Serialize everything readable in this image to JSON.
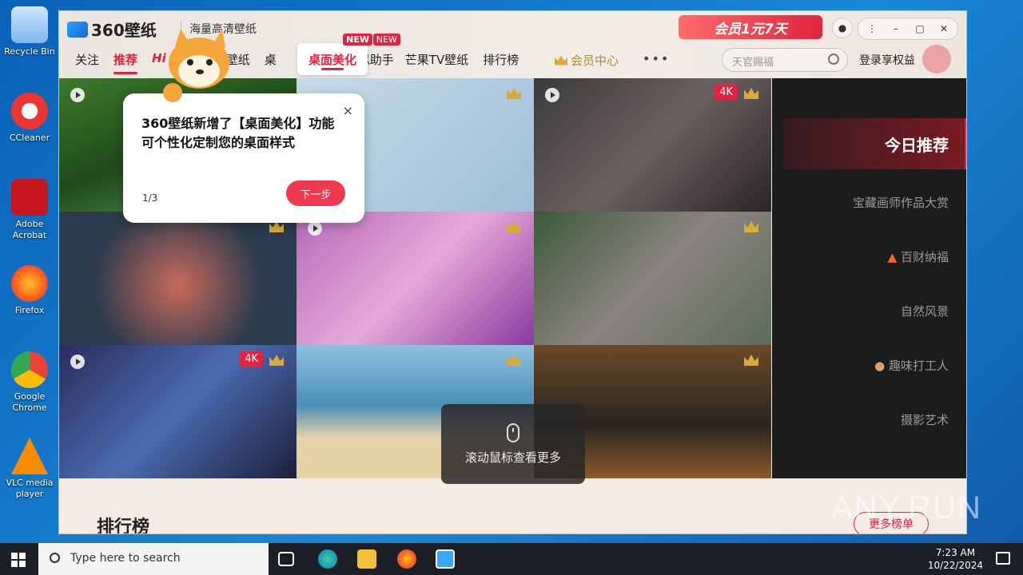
{
  "desktop": {
    "icons": [
      {
        "label": "Recycle Bin"
      },
      {
        "label": "CCleaner"
      },
      {
        "label": "Adobe Acrobat"
      },
      {
        "label": "Firefox"
      },
      {
        "label": "Google Chrome"
      },
      {
        "label": "VLC media player"
      }
    ]
  },
  "app": {
    "logo_text": "360壁纸",
    "subtitle": "海量高清壁纸",
    "promo": "会员1元7天",
    "nav": [
      {
        "label": "关注"
      },
      {
        "label": "推荐"
      },
      {
        "label": "动态壁纸"
      },
      {
        "label": "桌面美化",
        "badge": "NEW"
      },
      {
        "label": "AI助手",
        "badge": "NEW"
      },
      {
        "label": "芒果TV壁纸"
      },
      {
        "label": "排行榜"
      }
    ],
    "nav_fragments": {
      "fragment1": "关注",
      "fragment2": "推荐",
      "fragment3": "Hi",
      "fragment4": "经壁纸",
      "fragment5": "桌",
      "fragment6": "似助手"
    },
    "vip_label": "会员中心",
    "more_label": "•••",
    "search_placeholder": "天官赐福",
    "login_label": "登录享权益",
    "tile_badge": "4K",
    "side_menu": [
      {
        "label": "今日推荐"
      },
      {
        "label": "宝藏画师作品大赏"
      },
      {
        "label": "百财纳福"
      },
      {
        "label": "自然风景"
      },
      {
        "label": "趣味打工人"
      },
      {
        "label": "摄影艺术"
      }
    ],
    "popup": {
      "message": "360壁纸新增了【桌面美化】功能可个性化定制您的桌面样式",
      "step": "1/3",
      "next": "下一步",
      "close": "×"
    },
    "scroll_hint": "滚动鼠标查看更多",
    "rank_title": "排行榜",
    "rank_more": "更多榜单"
  },
  "taskbar": {
    "search_placeholder": "Type here to search",
    "time": "7:23 AM",
    "date": "10/22/2024"
  },
  "watermark": "ANY.RUN"
}
